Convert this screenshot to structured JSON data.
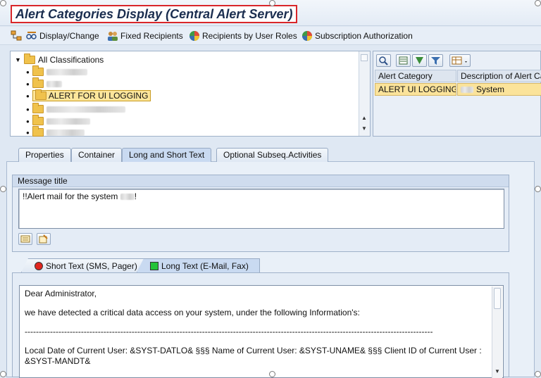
{
  "window": {
    "title": "Alert Categories Display (Central Alert Server)"
  },
  "toolbar": {
    "display_change": "Display/Change",
    "fixed_recipients": "Fixed Recipients",
    "recipients_by_roles": "Recipients by User Roles",
    "subscription_authorization": "Subscription Authorization"
  },
  "tree": {
    "root": "All Classifications",
    "selected_item": "ALERT FOR UI LOGGING"
  },
  "grid": {
    "columns": [
      "Alert Category",
      "Description of Alert Cat"
    ],
    "rows": [
      {
        "alert_category": "ALERT UI LOGGING",
        "description": "System"
      }
    ]
  },
  "tabs": [
    "Properties",
    "Container",
    "Long and Short Text",
    "Optional Subseq.Activities"
  ],
  "message": {
    "header": "Message title",
    "value_prefix": "!!Alert mail for the system ",
    "value_suffix": "!"
  },
  "text_tabs": {
    "short": "Short Text (SMS, Pager)",
    "long": "Long Text (E-Mail, Fax)"
  },
  "long_text": {
    "greeting": "Dear Administrator,",
    "intro": "we have detected a critical data access on your system, under the following Information's:",
    "separator": "-------------------------------------------------------------------------------------------------------------------------------------------------",
    "fields_line": "Local Date of Current User: &SYST-DATLO&    §§§ Name of Current User:  &SYST-UNAME& §§§ Client ID of Current User :",
    "fields_line2": "&SYST-MANDT&"
  },
  "colors": {
    "title_border": "#d9262a",
    "selection": "#fde69b",
    "status_red": "#e0261f",
    "status_green": "#22c33a"
  }
}
